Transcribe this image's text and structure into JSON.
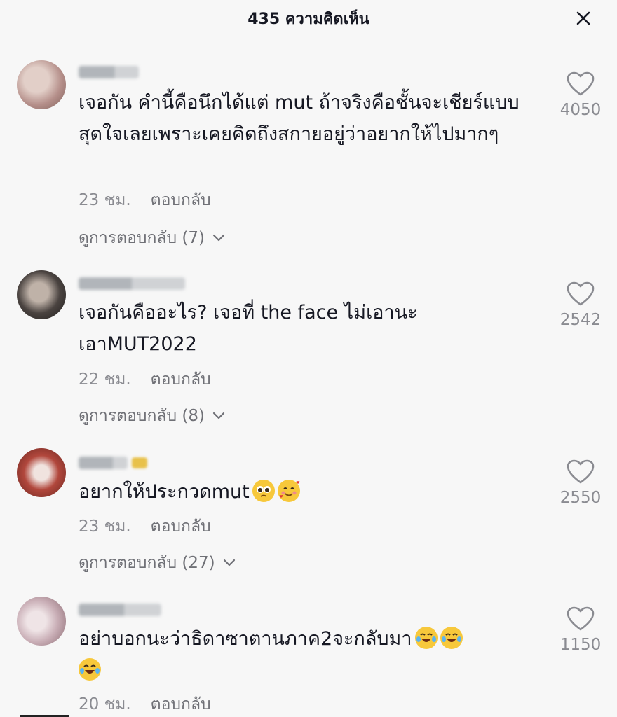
{
  "header": {
    "title": "435 ความคิดเห็น",
    "close_icon": "close-icon"
  },
  "comments": [
    {
      "avatar_color": "#b58f8a",
      "text": "เจอกัน คำนี้คือนึกได้แต่ mut ถ้าจริงคือชั้นจะเชียร์แบบสุดใจเลยเพราะเคยคิดถึงสกายอยู่ว่าอยากให้ไปมากๆ",
      "time": "23 ชม.",
      "reply_label": "ตอบกลับ",
      "view_replies": "ดูการตอบกลับ (7)",
      "likes": "4050"
    },
    {
      "avatar_color": "#4a4340",
      "text": "เจอกันคืออะไร? เจอที่ the face ไม่เอานะ เอาMUT2022",
      "time": "22 ชม.",
      "reply_label": "ตอบกลับ",
      "view_replies": "ดูการตอบกลับ (8)",
      "likes": "2542"
    },
    {
      "avatar_color": "#8e3a32",
      "text": "อยากให้ประกวดmut",
      "emojis": [
        "pleading-face-emoji",
        "smiling-face-with-hearts-emoji"
      ],
      "time": "23 ชม.",
      "reply_label": "ตอบกลับ",
      "view_replies": "ดูการตอบกลับ (27)",
      "likes": "2550"
    },
    {
      "avatar_color": "#c9aeb6",
      "text": "อย่าบอกนะว่าธิดาซาตานภาค2จะกลับมา",
      "emojis": [
        "tears-of-joy-emoji",
        "tears-of-joy-emoji",
        "tears-of-joy-emoji"
      ],
      "time": "20 ชม.",
      "reply_label": "ตอบกลับ",
      "likes": "1150"
    }
  ],
  "colors": {
    "background": "#f7f7f7",
    "text_primary": "#161823",
    "text_secondary": "#8a8b91"
  }
}
